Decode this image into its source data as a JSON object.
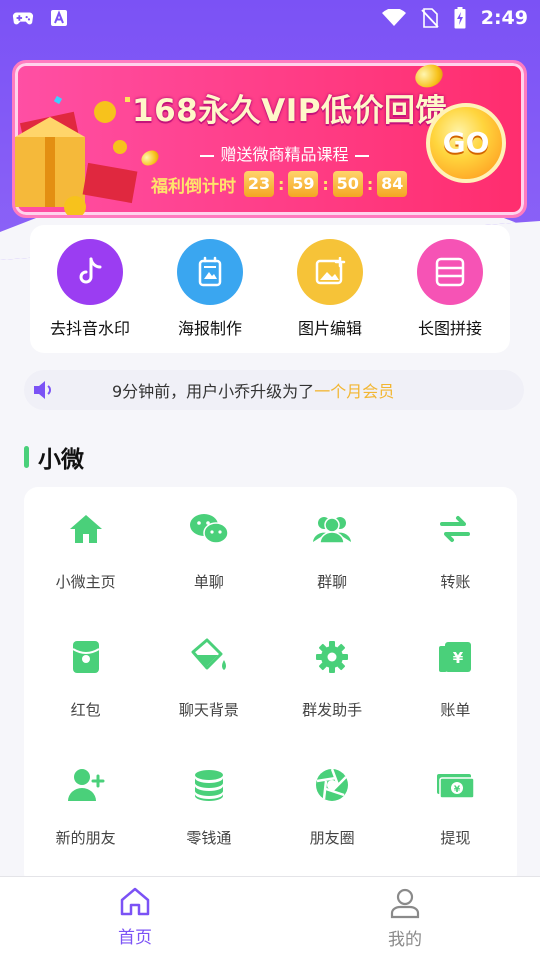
{
  "status_bar": {
    "time": "2:49",
    "left_icons": [
      "gamepad-icon",
      "a-icon"
    ],
    "right_icons": [
      "wifi-icon",
      "no-sim-icon",
      "battery-charging-icon"
    ]
  },
  "banner": {
    "title": "168永久VIP低价回馈",
    "subtitle": "赠送微商精品课程",
    "countdown_label": "福利倒计时",
    "countdown": [
      "23",
      "59",
      "50",
      "84"
    ],
    "go_label": "GO"
  },
  "tools": [
    {
      "label": "去抖音水印",
      "icon": "tiktok-icon",
      "color": "#9b3df2"
    },
    {
      "label": "海报制作",
      "icon": "poster-icon",
      "color": "#3aa6f0"
    },
    {
      "label": "图片编辑",
      "icon": "image-edit-icon",
      "color": "#f6c338"
    },
    {
      "label": "长图拼接",
      "icon": "long-image-icon",
      "color": "#f653b5"
    }
  ],
  "notice": {
    "text": "9分钟前，用户小乔升级为了",
    "highlight": "一个月会员",
    "icon": "speaker-icon"
  },
  "section": {
    "title": "小微"
  },
  "grid": [
    {
      "label": "小微主页",
      "icon": "home-icon"
    },
    {
      "label": "单聊",
      "icon": "wechat-icon"
    },
    {
      "label": "群聊",
      "icon": "group-icon"
    },
    {
      "label": "转账",
      "icon": "transfer-icon"
    },
    {
      "label": "红包",
      "icon": "red-packet-icon"
    },
    {
      "label": "聊天背景",
      "icon": "paint-bucket-icon"
    },
    {
      "label": "群发助手",
      "icon": "gear-icon"
    },
    {
      "label": "账单",
      "icon": "bill-icon"
    },
    {
      "label": "新的朋友",
      "icon": "add-friend-icon"
    },
    {
      "label": "零钱通",
      "icon": "coins-icon"
    },
    {
      "label": "朋友圈",
      "icon": "moments-icon"
    },
    {
      "label": "提现",
      "icon": "cash-icon"
    }
  ],
  "colors": {
    "accent": "#7b52f5",
    "green": "#4ad07a"
  },
  "bottom_nav": [
    {
      "label": "首页",
      "icon": "home-outline-icon",
      "active": true
    },
    {
      "label": "我的",
      "icon": "user-icon",
      "active": false
    }
  ]
}
